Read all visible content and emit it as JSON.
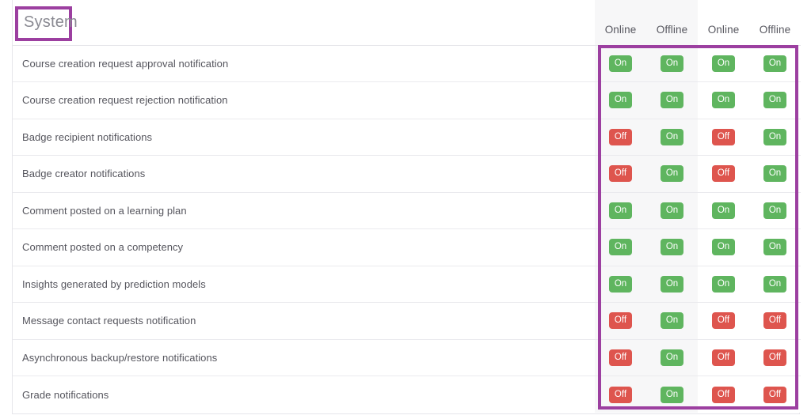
{
  "header": {
    "section_title": "System",
    "columns": [
      {
        "label": "Online",
        "group": "personal",
        "shaded": true
      },
      {
        "label": "Offline",
        "group": "personal",
        "shaded": true
      },
      {
        "label": "Online",
        "group": "forced",
        "shaded": false
      },
      {
        "label": "Offline",
        "group": "forced",
        "shaded": false
      }
    ]
  },
  "colors": {
    "on_badge": "#5fb55f",
    "off_badge": "#de554e",
    "annotation_outline": "#9c3fa0",
    "row_border": "#eaeaee",
    "shaded_column": "#f7f7f8",
    "label_text": "#55555d",
    "title_text": "#8a8a92"
  },
  "annotations": [
    {
      "name": "system-title-highlight",
      "color": "#9c3fa0"
    },
    {
      "name": "toggle-columns-highlight",
      "color": "#9c3fa0"
    }
  ],
  "rows": [
    {
      "label": "Course creation request approval notification",
      "toggles": [
        "On",
        "On",
        "On",
        "On"
      ]
    },
    {
      "label": "Course creation request rejection notification",
      "toggles": [
        "On",
        "On",
        "On",
        "On"
      ]
    },
    {
      "label": "Badge recipient notifications",
      "toggles": [
        "Off",
        "On",
        "Off",
        "On"
      ]
    },
    {
      "label": "Badge creator notifications",
      "toggles": [
        "Off",
        "On",
        "Off",
        "On"
      ]
    },
    {
      "label": "Comment posted on a learning plan",
      "toggles": [
        "On",
        "On",
        "On",
        "On"
      ]
    },
    {
      "label": "Comment posted on a competency",
      "toggles": [
        "On",
        "On",
        "On",
        "On"
      ]
    },
    {
      "label": "Insights generated by prediction models",
      "toggles": [
        "On",
        "On",
        "On",
        "On"
      ]
    },
    {
      "label": "Message contact requests notification",
      "toggles": [
        "Off",
        "On",
        "Off",
        "Off"
      ]
    },
    {
      "label": "Asynchronous backup/restore notifications",
      "toggles": [
        "Off",
        "On",
        "Off",
        "Off"
      ]
    },
    {
      "label": "Grade notifications",
      "toggles": [
        "Off",
        "On",
        "Off",
        "Off"
      ]
    }
  ]
}
